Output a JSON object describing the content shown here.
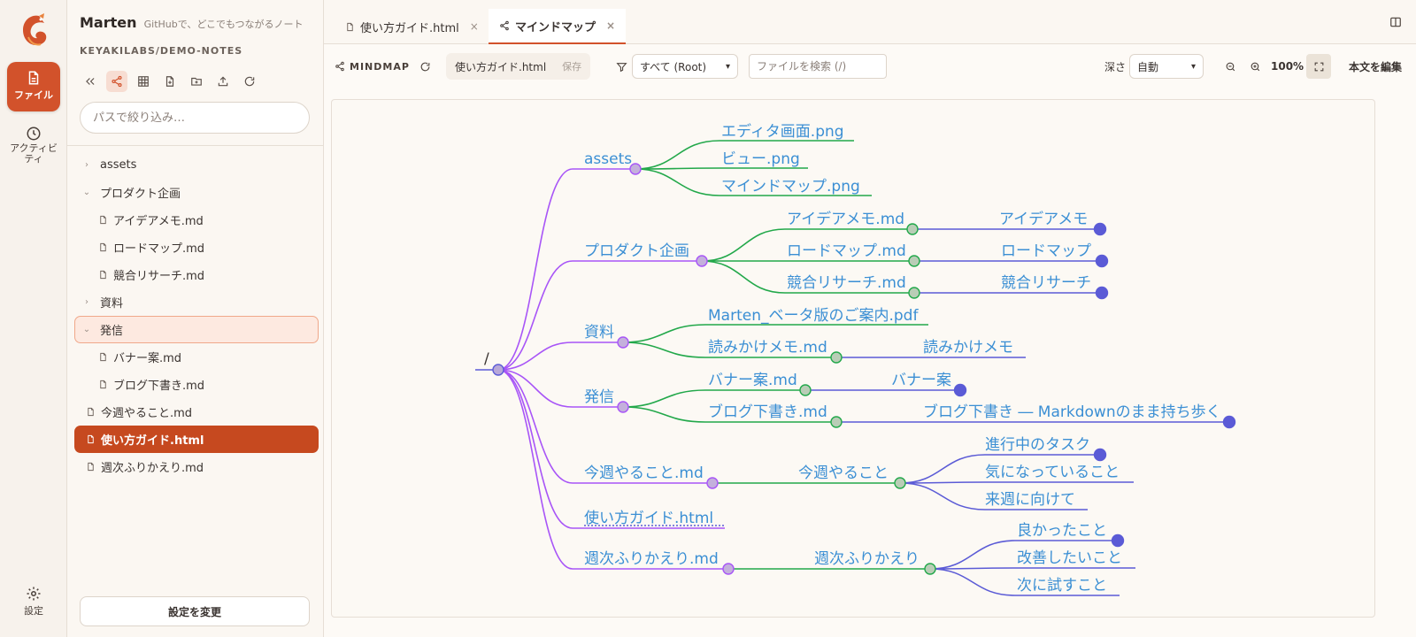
{
  "activity": {
    "files_label": "ファイル",
    "activity_label": "アクティビティ",
    "settings_label": "設定"
  },
  "sidebar": {
    "brand_name": "Marten",
    "brand_tagline": "GitHubで、どこでもつながるノート",
    "repo": "KEYAKILABS/DEMO-NOTES",
    "filter_placeholder": "パスで絞り込み…",
    "tree": [
      {
        "label": "assets",
        "type": "folder",
        "expanded": false,
        "depth": 0
      },
      {
        "label": "プロダクト企画",
        "type": "folder",
        "expanded": true,
        "depth": 0
      },
      {
        "label": "アイデアメモ.md",
        "type": "file",
        "depth": 1
      },
      {
        "label": "ロードマップ.md",
        "type": "file",
        "depth": 1
      },
      {
        "label": "競合リサーチ.md",
        "type": "file",
        "depth": 1
      },
      {
        "label": "資料",
        "type": "folder",
        "expanded": false,
        "depth": 0
      },
      {
        "label": "発信",
        "type": "folder",
        "expanded": true,
        "depth": 0,
        "selected": true
      },
      {
        "label": "バナー案.md",
        "type": "file",
        "depth": 1
      },
      {
        "label": "ブログ下書き.md",
        "type": "file",
        "depth": 1
      },
      {
        "label": "今週やること.md",
        "type": "file",
        "depth": 0
      },
      {
        "label": "使い方ガイド.html",
        "type": "file",
        "depth": 0,
        "active": true
      },
      {
        "label": "週次ふりかえり.md",
        "type": "file",
        "depth": 0
      }
    ],
    "settings_button": "設定を変更"
  },
  "tabs": [
    {
      "label": "使い方ガイド.html",
      "active": false,
      "icon": "file-icon"
    },
    {
      "label": "マインドマップ",
      "active": true,
      "icon": "share-icon"
    }
  ],
  "toolbar": {
    "mode_label": "MINDMAP",
    "file": "使い方ガイド.html",
    "save": "保存",
    "scope": "すべて (Root)",
    "search_placeholder": "ファイルを検索 (/)",
    "depth_label": "深さ",
    "depth_value": "自動",
    "zoom": "100%",
    "edit_label": "本文を編集"
  },
  "mindmap": {
    "root": "/",
    "colors": {
      "level1": "#a855f7",
      "level2": "#22a84a",
      "level3": "#5b5bd6",
      "text": "#3b8fd4"
    },
    "nodes": {
      "assets": "assets",
      "assets_c1": "エディタ画面.png",
      "assets_c2": "ビュー.png",
      "assets_c3": "マインドマップ.png",
      "plan": "プロダクト企画",
      "plan_c1": "アイデアメモ.md",
      "plan_c1_h": "アイデアメモ",
      "plan_c2": "ロードマップ.md",
      "plan_c2_h": "ロードマップ",
      "plan_c3": "競合リサーチ.md",
      "plan_c3_h": "競合リサーチ",
      "docs": "資料",
      "docs_c1": "Marten_ベータ版のご案内.pdf",
      "docs_c2": "読みかけメモ.md",
      "docs_c2_h": "読みかけメモ",
      "pub": "発信",
      "pub_c1": "バナー案.md",
      "pub_c1_h": "バナー案",
      "pub_c2": "ブログ下書き.md",
      "pub_c2_h": "ブログ下書き ― Markdownのまま持ち歩く",
      "week": "今週やること.md",
      "week_h": "今週やること",
      "week_s1": "進行中のタスク",
      "week_s2": "気になっていること",
      "week_s3": "来週に向けて",
      "guide": "使い方ガイド.html",
      "review": "週次ふりかえり.md",
      "review_h": "週次ふりかえり",
      "review_s1": "良かったこと",
      "review_s2": "改善したいこと",
      "review_s3": "次に試すこと"
    }
  }
}
